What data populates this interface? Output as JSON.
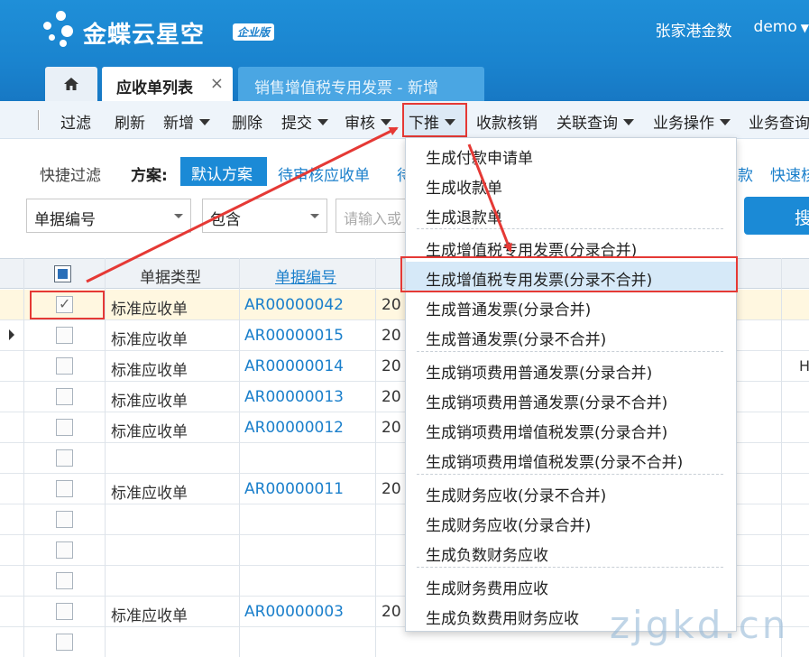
{
  "header": {
    "logo_text": "金蝶云星空",
    "logo_badge": "企业版",
    "org": "张家港金数",
    "user": "demo",
    "user_caret": "▼"
  },
  "tabs": [
    {
      "label": "应收单列表",
      "close": "×"
    },
    {
      "label": "销售增值税专用发票 - 新增"
    }
  ],
  "toolbar": {
    "filter": "过滤",
    "refresh": "刷新",
    "new": "新增",
    "delete": "删除",
    "submit": "提交",
    "audit": "审核",
    "push": "下推",
    "writeoff": "收款核销",
    "related": "关联查询",
    "biz_ops": "业务操作",
    "biz_query": "业务查询"
  },
  "filter": {
    "quick_filter": "快捷过滤",
    "scheme_label": "方案:",
    "scheme_default": "默认方案",
    "scheme_pending": "待审核应收单",
    "scheme_partial_left": "待",
    "scheme_partial_right": "款",
    "scheme_fast": "快速核",
    "field_combo": "单据编号",
    "op_combo": "包含",
    "search_placeholder": "请输入或",
    "search_button": "搜"
  },
  "grid": {
    "col_type": "单据类型",
    "col_no": "单据编号",
    "rows": [
      {
        "type": "标准应收单",
        "no": "AR00000042",
        "date": "20",
        "checked": true
      },
      {
        "type": "标准应收单",
        "no": "AR00000015",
        "date": "20",
        "checked": false
      },
      {
        "type": "标准应收单",
        "no": "AR00000014",
        "date": "20",
        "checked": false,
        "extra": "H"
      },
      {
        "type": "标准应收单",
        "no": "AR00000013",
        "date": "20",
        "checked": false
      },
      {
        "type": "标准应收单",
        "no": "AR00000012",
        "date": "20",
        "checked": false
      },
      {
        "type": "",
        "no": "",
        "date": "",
        "checked": false
      },
      {
        "type": "标准应收单",
        "no": "AR00000011",
        "date": "20",
        "checked": false
      },
      {
        "type": "",
        "no": "",
        "date": "",
        "checked": false
      },
      {
        "type": "",
        "no": "",
        "date": "",
        "checked": false
      },
      {
        "type": "",
        "no": "",
        "date": "",
        "checked": false
      },
      {
        "type": "标准应收单",
        "no": "AR00000003",
        "date": "20",
        "checked": false
      },
      {
        "type": "",
        "no": "",
        "date": "",
        "checked": false
      }
    ]
  },
  "push_menu": {
    "items": [
      "生成付款申请单",
      "生成收款单",
      "生成退款单",
      "生成增值税专用发票(分录合并)",
      "生成增值税专用发票(分录不合并)",
      "生成普通发票(分录合并)",
      "生成普通发票(分录不合并)",
      "生成销项费用普通发票(分录合并)",
      "生成销项费用普通发票(分录不合并)",
      "生成销项费用增值税发票(分录合并)",
      "生成销项费用增值税发票(分录不合并)",
      "生成财务应收(分录不合并)",
      "生成财务应收(分录合并)",
      "生成负数财务应收",
      "生成财务费用应收",
      "生成负数费用财务应收"
    ],
    "selected_index": 4
  },
  "watermark": "zjgkd.cn",
  "colors": {
    "brand_blue": "#1b8ad6",
    "annotation_red": "#e53935",
    "link_blue": "#1a7fcb"
  }
}
